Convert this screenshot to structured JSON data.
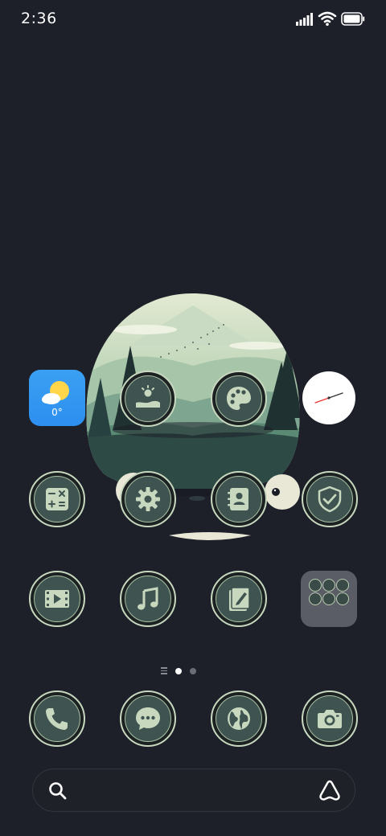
{
  "status_bar": {
    "time": "2:36"
  },
  "weather": {
    "temperature": "0°"
  },
  "colors": {
    "background": "#1d1f29",
    "icon_ring": "#c7d8bf",
    "icon_fill": "#3f5350",
    "weather_blue": "#2d8ff0",
    "folder_gray": "#5b5d66"
  },
  "apps": [
    {
      "name": "gallery",
      "icon": "image-icon"
    },
    {
      "name": "themes",
      "icon": "palette-icon"
    },
    {
      "name": "calculator",
      "icon": "calculator-icon"
    },
    {
      "name": "settings",
      "icon": "gear-icon"
    },
    {
      "name": "contacts",
      "icon": "contacts-icon"
    },
    {
      "name": "security",
      "icon": "shield-check-icon"
    },
    {
      "name": "video",
      "icon": "video-icon"
    },
    {
      "name": "music",
      "icon": "music-icon"
    },
    {
      "name": "notes",
      "icon": "notes-icon"
    }
  ],
  "dock": [
    {
      "name": "phone",
      "icon": "phone-icon"
    },
    {
      "name": "messages",
      "icon": "chat-icon"
    },
    {
      "name": "browser",
      "icon": "globe-icon"
    },
    {
      "name": "camera",
      "icon": "camera-icon"
    }
  ],
  "page_indicator": {
    "pages": 2,
    "current_page": 1
  },
  "search": {
    "search_icon": "search-icon",
    "assistant_icon": "assistant-icon"
  }
}
